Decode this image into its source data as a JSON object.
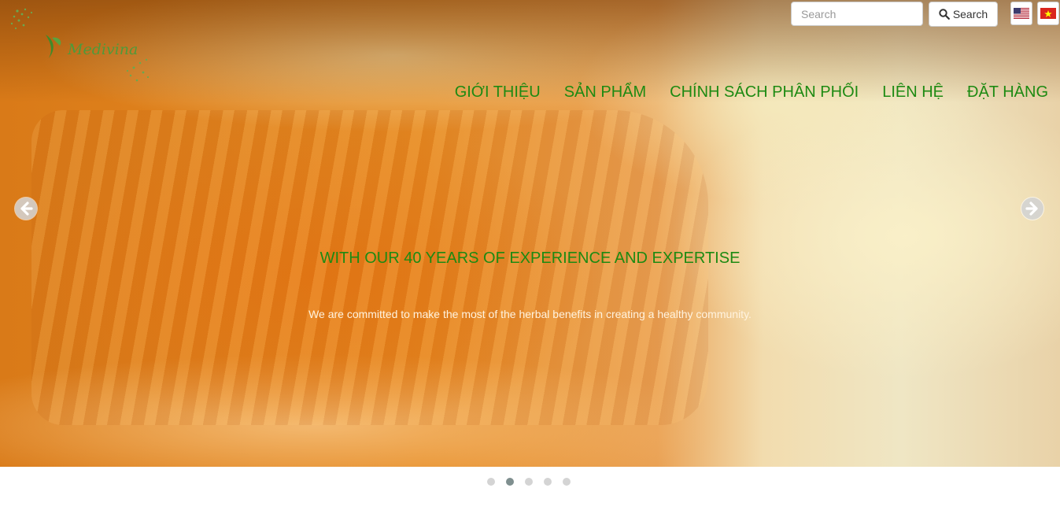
{
  "brand": {
    "logo_text": "Medivina"
  },
  "search": {
    "placeholder": "Search",
    "button_label": "Search"
  },
  "languages": [
    {
      "code": "en",
      "icon": "us-flag-icon"
    },
    {
      "code": "vi",
      "icon": "vietnam-flag-icon"
    }
  ],
  "nav": {
    "items": [
      {
        "label": "GIỚI THIỆU"
      },
      {
        "label": "SẢN PHẨM"
      },
      {
        "label": "CHÍNH SÁCH PHÂN PHỐI"
      },
      {
        "label": "LIÊN HỆ"
      },
      {
        "label": "ĐẶT HÀNG"
      }
    ]
  },
  "carousel": {
    "title": "WITH OUR 40 YEARS OF EXPERIENCE AND EXPERTISE",
    "subtitle": "We are committed to make the most of the herbal benefits in creating a healthy community.",
    "prev_icon": "arrow-left-circle-icon",
    "next_icon": "arrow-right-circle-icon",
    "slide_count": 5,
    "active_index": 1
  },
  "colors": {
    "nav_green": "#1d8a12",
    "logo_green": "#4f9a3a",
    "indicator_active": "#7f8f8f",
    "indicator_inactive": "#d4d4d4"
  }
}
